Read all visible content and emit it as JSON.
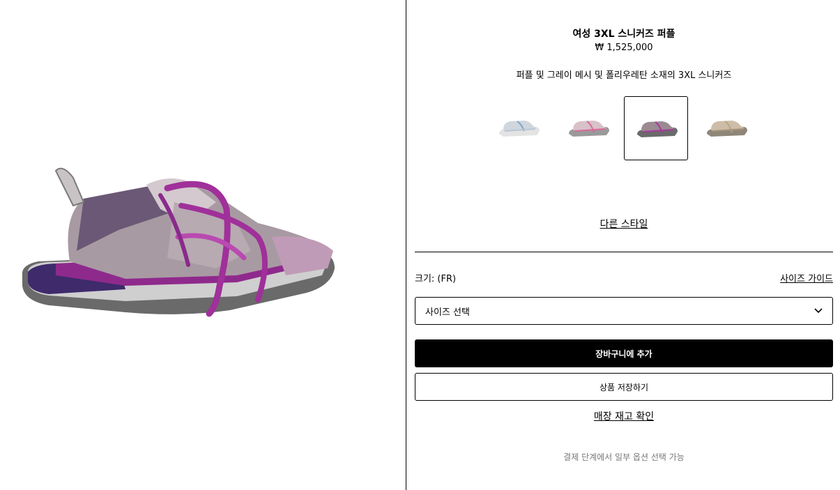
{
  "product": {
    "title": "여성 3XL 스니커즈 퍼플",
    "price": "₩ 1,525,000",
    "description": "퍼플 및 그레이 메시 및 폴리우레탄 소재의 3XL 스니커즈"
  },
  "variants": [
    {
      "name": "white-blue",
      "color": "#cfd6dd",
      "accent": "#7fa6c9",
      "selected": false
    },
    {
      "name": "pink-grey",
      "color": "#d8c1c8",
      "accent": "#d86a9a",
      "selected": false
    },
    {
      "name": "purple",
      "color": "#9b8a92",
      "accent": "#a53a9a",
      "selected": true
    },
    {
      "name": "beige",
      "color": "#cdbda8",
      "accent": "#b9a58a",
      "selected": false
    }
  ],
  "links": {
    "other_style": "다른 스타일",
    "size_guide": "사이즈 가이드",
    "store_stock": "매장 재고 확인"
  },
  "size": {
    "label": "크기: (FR)",
    "select_value": "사이즈 선택"
  },
  "buttons": {
    "add_to_cart": "장바구니에 추가",
    "save_item": "상품 저장하기"
  },
  "notes": {
    "checkout": "결제 단계에서 일부 옵션 선택 가능"
  },
  "icons": {
    "select_caret": "chevron-down-icon"
  },
  "colors": {
    "primary": "#000000",
    "muted_text": "#777777",
    "shoe_purple": "#8a2a8c",
    "shoe_grey": "#9a8f97"
  }
}
